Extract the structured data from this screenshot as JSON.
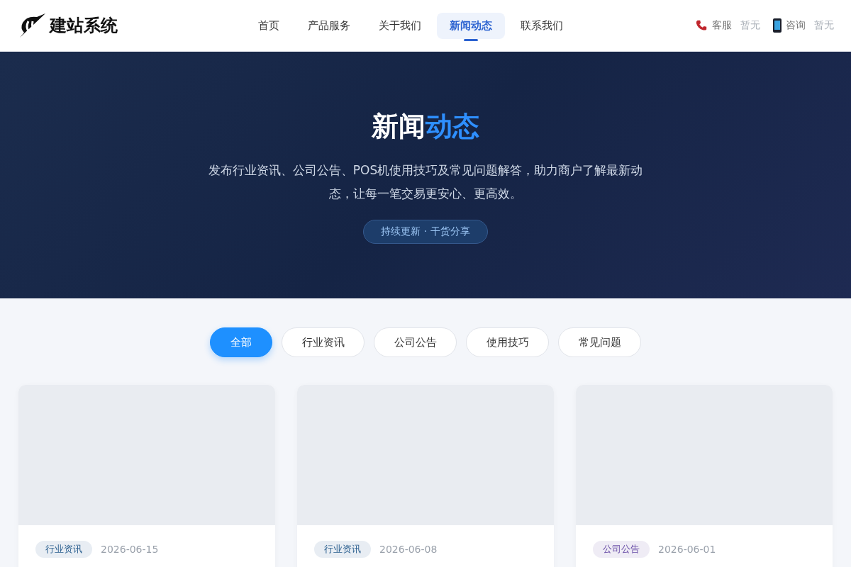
{
  "header": {
    "logo_text": "建站系统",
    "nav": [
      {
        "label": "首页",
        "selected": false
      },
      {
        "label": "产品服务",
        "selected": false
      },
      {
        "label": "关于我们",
        "selected": false
      },
      {
        "label": "新闻动态",
        "selected": true
      },
      {
        "label": "联系我们",
        "selected": false
      }
    ],
    "contacts": [
      {
        "kind": "phone",
        "label": "客服",
        "value": "暂无"
      },
      {
        "kind": "mobile",
        "label": "咨询",
        "value": "暂无"
      }
    ]
  },
  "hero": {
    "title": [
      {
        "text": "新闻",
        "accent": false
      },
      {
        "text": "动态",
        "accent": true
      }
    ],
    "subtitle": "发布行业资讯、公司公告、POS机使用技巧及常见问题解答，助力商户了解最新动态，让每一笔交易更安心、更高效。",
    "badge": "持续更新 · 干货分享"
  },
  "filters": [
    {
      "label": "全部",
      "selected": true
    },
    {
      "label": "行业资讯",
      "selected": false
    },
    {
      "label": "公司公告",
      "selected": false
    },
    {
      "label": "使用技巧",
      "selected": false
    },
    {
      "label": "常见问题",
      "selected": false
    }
  ],
  "cards": [
    {
      "tag": "行业资讯",
      "color": "#2a5f8f",
      "date": "2026-06-15"
    },
    {
      "tag": "行业资讯",
      "color": "#2a5f8f",
      "date": "2026-06-08"
    },
    {
      "tag": "公司公告",
      "color": "#6a4ea8",
      "date": "2026-06-01"
    }
  ]
}
